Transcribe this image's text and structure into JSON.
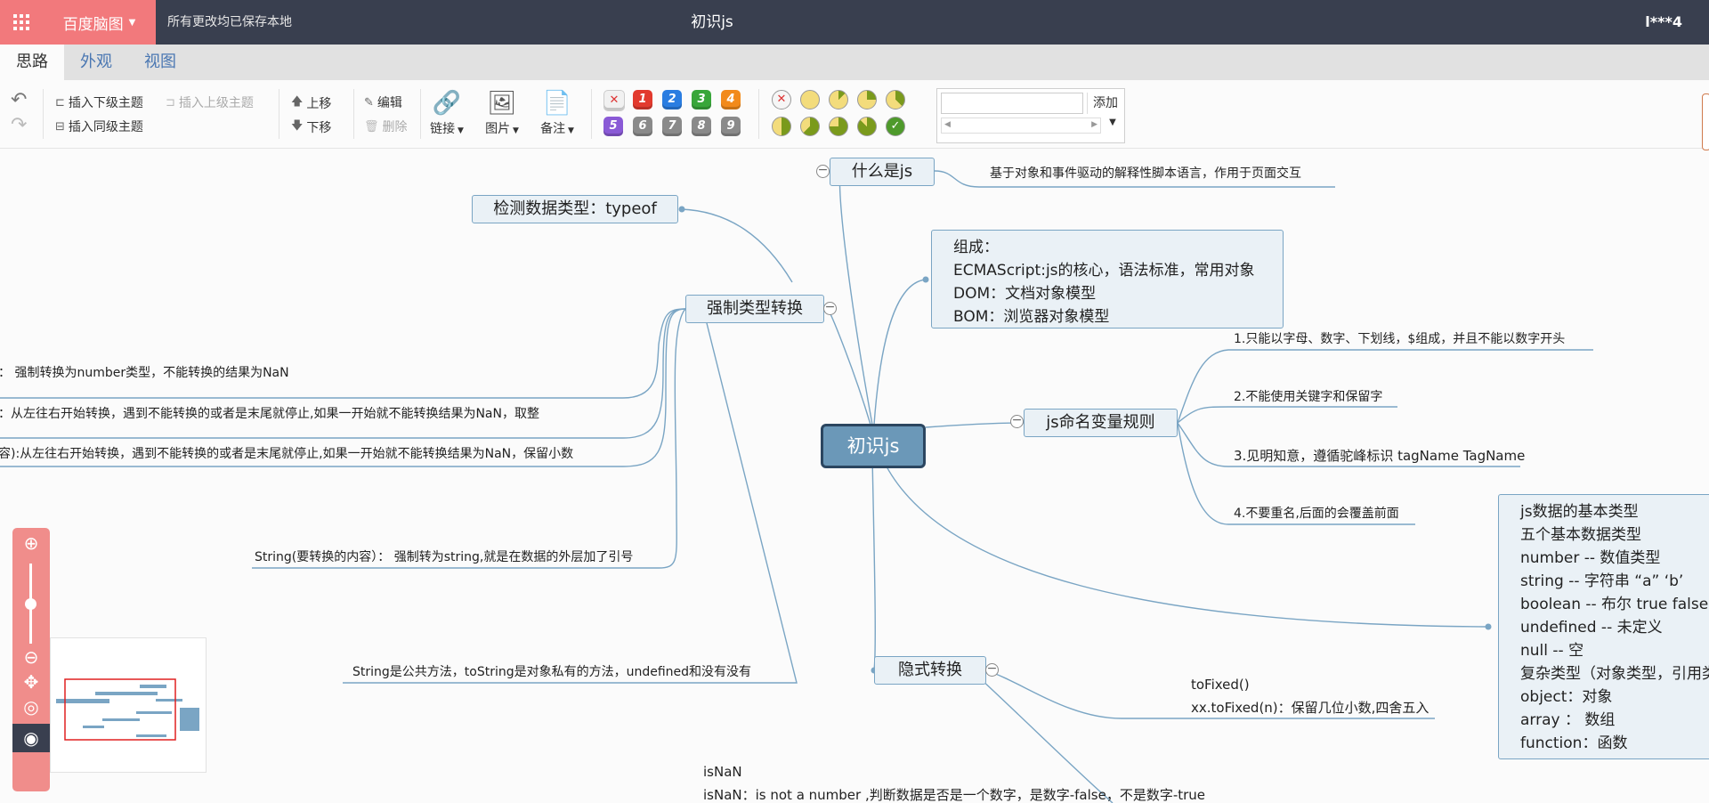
{
  "app": {
    "brand": "百度脑图",
    "save_status": "所有更改均已保存本地",
    "doc_title": "初识js",
    "user": "l***4"
  },
  "tabs": [
    {
      "label": "思路",
      "active": true
    },
    {
      "label": "外观",
      "active": false
    },
    {
      "label": "视图",
      "active": false
    }
  ],
  "toolbar": {
    "insert_child": "插入下级主题",
    "insert_parent": "插入上级主题",
    "insert_sibling": "插入同级主题",
    "move_up": "上移",
    "move_down": "下移",
    "edit": "编辑",
    "delete": "删除",
    "link": "链接",
    "image": "图片",
    "note": "备注",
    "priorities": [
      "1",
      "2",
      "3",
      "4",
      "5",
      "6",
      "7",
      "8",
      "9"
    ],
    "priority_colors": [
      "#e23a2e",
      "#2a7de1",
      "#39a63a",
      "#f28a1b",
      "#8a5ad6",
      "#8a8a8a",
      "#8a8a8a",
      "#8a8a8a",
      "#8a8a8a"
    ],
    "tag_add": "添加",
    "tag_input_value": ""
  },
  "mindmap": {
    "root": "初识js",
    "what_is_js": "什么是js",
    "what_is_js_desc": "基于对象和事件驱动的解释性脚本语言，作用于页面交互",
    "composition": [
      "组成：",
      "ECMAScript:js的核心，语法标准，常用对象",
      "DOM：文档对象模型",
      "BOM：浏览器对象模型"
    ],
    "typeof_node": "检测数据类型：typeof",
    "force_convert": "强制类型转换",
    "force_items": [
      "：  强制转换为number类型，不能转换的结果为NaN",
      "：从左往右开始转换，遇到不能转换的或者是末尾就停止,如果一开始就不能转换结果为NaN，取整",
      "容):从左往右开始转换，遇到不能转换的或者是末尾就停止,如果一开始就不能转换结果为NaN，保留小数",
      "String(要转换的内容）：  强制转为string,就是在数据的外层加了引号",
      "String是公共方法，toString是对象私有的方法，undefined和没有没有"
    ],
    "naming_rules": "js命名变量规则",
    "naming_items": [
      "1.只能以字母、数字、下划线，$组成，并且不能以数字开头",
      "2.不能使用关键字和保留字",
      "3.见明知意，遵循驼峰标识 tagName TagName",
      "4.不要重名,后面的会覆盖前面"
    ],
    "data_types": [
      "js数据的基本类型",
      "五个基本数据类型",
      "number -- 数值类型",
      "string -- 字符串 “a”  ‘b’",
      "boolean -- 布尔 true false",
      "undefined -- 未定义",
      "null -- 空",
      "复杂类型（对象类型，引用类",
      "object：对象",
      "array ：  数组",
      "function：函数"
    ],
    "implicit": "隐式转换",
    "tofixed": [
      "toFixed()",
      "xx.toFixed(n)：保留几位小数,四舍五入"
    ],
    "isnan": [
      "isNaN",
      "isNaN：is not a number ,判断数据是否是一个数字，是数字-false，不是数字-true"
    ]
  },
  "colors": {
    "topbar": "#393f4f",
    "brand": "#f2797c",
    "root_fill": "#6b98b8",
    "node_fill": "#eaf1f6",
    "link": "#7aa5c4"
  },
  "zoom_level_percent": 50
}
